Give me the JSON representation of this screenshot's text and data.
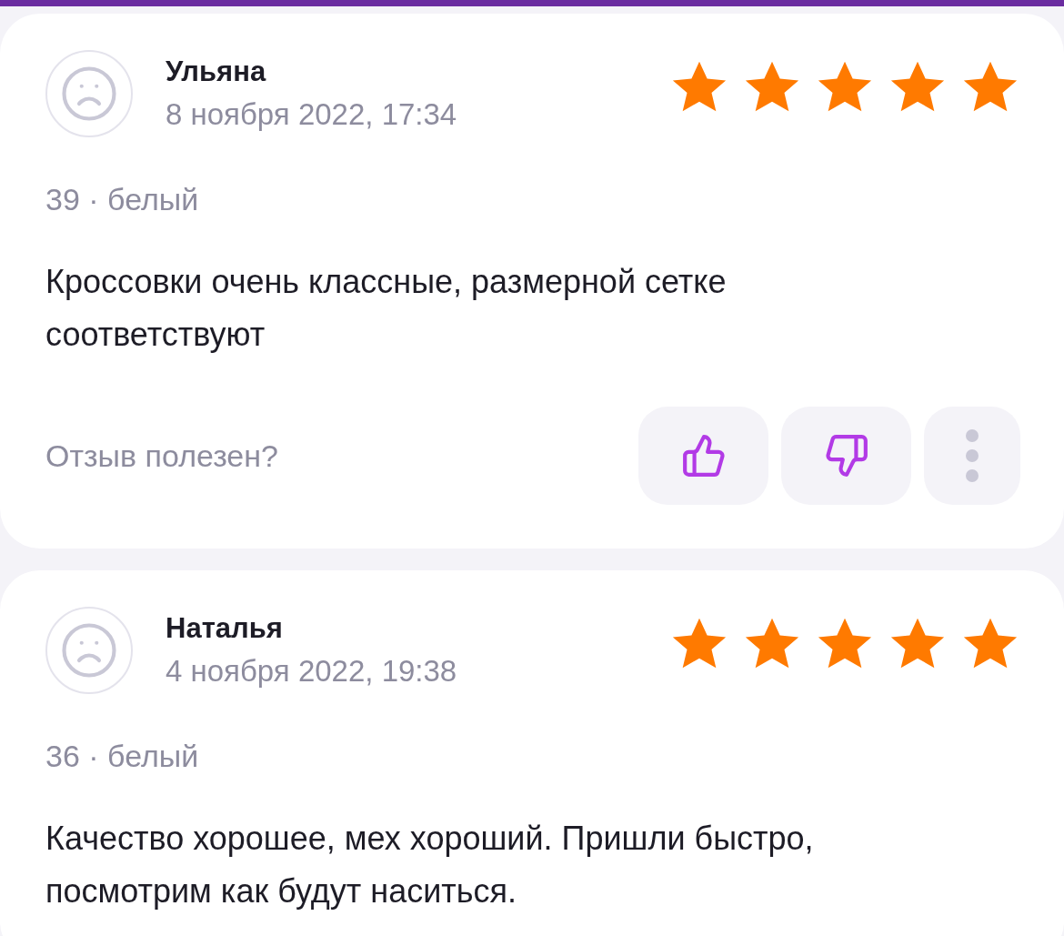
{
  "reviews": [
    {
      "author": "Ульяна",
      "date": "8 ноября 2022, 17:34",
      "stars": 5,
      "variant": "39 · белый",
      "text": "Кроссовки очень классные, размерной сетке соответствуют",
      "helpful_prompt": "Отзыв полезен?"
    },
    {
      "author": "Наталья",
      "date": "4 ноября 2022, 19:38",
      "stars": 5,
      "variant": "36 · белый",
      "text": "Качество хорошее, мех хороший. Пришли быстро, посмотрим как будут наситься."
    }
  ]
}
